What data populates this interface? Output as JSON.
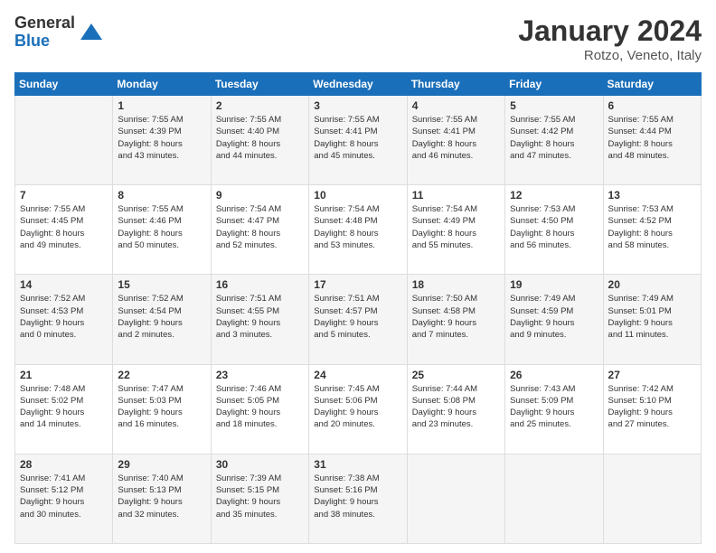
{
  "logo": {
    "general": "General",
    "blue": "Blue"
  },
  "header": {
    "month": "January 2024",
    "location": "Rotzo, Veneto, Italy"
  },
  "weekdays": [
    "Sunday",
    "Monday",
    "Tuesday",
    "Wednesday",
    "Thursday",
    "Friday",
    "Saturday"
  ],
  "weeks": [
    [
      {
        "day": "",
        "info": ""
      },
      {
        "day": "1",
        "info": "Sunrise: 7:55 AM\nSunset: 4:39 PM\nDaylight: 8 hours\nand 43 minutes."
      },
      {
        "day": "2",
        "info": "Sunrise: 7:55 AM\nSunset: 4:40 PM\nDaylight: 8 hours\nand 44 minutes."
      },
      {
        "day": "3",
        "info": "Sunrise: 7:55 AM\nSunset: 4:41 PM\nDaylight: 8 hours\nand 45 minutes."
      },
      {
        "day": "4",
        "info": "Sunrise: 7:55 AM\nSunset: 4:41 PM\nDaylight: 8 hours\nand 46 minutes."
      },
      {
        "day": "5",
        "info": "Sunrise: 7:55 AM\nSunset: 4:42 PM\nDaylight: 8 hours\nand 47 minutes."
      },
      {
        "day": "6",
        "info": "Sunrise: 7:55 AM\nSunset: 4:44 PM\nDaylight: 8 hours\nand 48 minutes."
      }
    ],
    [
      {
        "day": "7",
        "info": "Sunrise: 7:55 AM\nSunset: 4:45 PM\nDaylight: 8 hours\nand 49 minutes."
      },
      {
        "day": "8",
        "info": "Sunrise: 7:55 AM\nSunset: 4:46 PM\nDaylight: 8 hours\nand 50 minutes."
      },
      {
        "day": "9",
        "info": "Sunrise: 7:54 AM\nSunset: 4:47 PM\nDaylight: 8 hours\nand 52 minutes."
      },
      {
        "day": "10",
        "info": "Sunrise: 7:54 AM\nSunset: 4:48 PM\nDaylight: 8 hours\nand 53 minutes."
      },
      {
        "day": "11",
        "info": "Sunrise: 7:54 AM\nSunset: 4:49 PM\nDaylight: 8 hours\nand 55 minutes."
      },
      {
        "day": "12",
        "info": "Sunrise: 7:53 AM\nSunset: 4:50 PM\nDaylight: 8 hours\nand 56 minutes."
      },
      {
        "day": "13",
        "info": "Sunrise: 7:53 AM\nSunset: 4:52 PM\nDaylight: 8 hours\nand 58 minutes."
      }
    ],
    [
      {
        "day": "14",
        "info": "Sunrise: 7:52 AM\nSunset: 4:53 PM\nDaylight: 9 hours\nand 0 minutes."
      },
      {
        "day": "15",
        "info": "Sunrise: 7:52 AM\nSunset: 4:54 PM\nDaylight: 9 hours\nand 2 minutes."
      },
      {
        "day": "16",
        "info": "Sunrise: 7:51 AM\nSunset: 4:55 PM\nDaylight: 9 hours\nand 3 minutes."
      },
      {
        "day": "17",
        "info": "Sunrise: 7:51 AM\nSunset: 4:57 PM\nDaylight: 9 hours\nand 5 minutes."
      },
      {
        "day": "18",
        "info": "Sunrise: 7:50 AM\nSunset: 4:58 PM\nDaylight: 9 hours\nand 7 minutes."
      },
      {
        "day": "19",
        "info": "Sunrise: 7:49 AM\nSunset: 4:59 PM\nDaylight: 9 hours\nand 9 minutes."
      },
      {
        "day": "20",
        "info": "Sunrise: 7:49 AM\nSunset: 5:01 PM\nDaylight: 9 hours\nand 11 minutes."
      }
    ],
    [
      {
        "day": "21",
        "info": "Sunrise: 7:48 AM\nSunset: 5:02 PM\nDaylight: 9 hours\nand 14 minutes."
      },
      {
        "day": "22",
        "info": "Sunrise: 7:47 AM\nSunset: 5:03 PM\nDaylight: 9 hours\nand 16 minutes."
      },
      {
        "day": "23",
        "info": "Sunrise: 7:46 AM\nSunset: 5:05 PM\nDaylight: 9 hours\nand 18 minutes."
      },
      {
        "day": "24",
        "info": "Sunrise: 7:45 AM\nSunset: 5:06 PM\nDaylight: 9 hours\nand 20 minutes."
      },
      {
        "day": "25",
        "info": "Sunrise: 7:44 AM\nSunset: 5:08 PM\nDaylight: 9 hours\nand 23 minutes."
      },
      {
        "day": "26",
        "info": "Sunrise: 7:43 AM\nSunset: 5:09 PM\nDaylight: 9 hours\nand 25 minutes."
      },
      {
        "day": "27",
        "info": "Sunrise: 7:42 AM\nSunset: 5:10 PM\nDaylight: 9 hours\nand 27 minutes."
      }
    ],
    [
      {
        "day": "28",
        "info": "Sunrise: 7:41 AM\nSunset: 5:12 PM\nDaylight: 9 hours\nand 30 minutes."
      },
      {
        "day": "29",
        "info": "Sunrise: 7:40 AM\nSunset: 5:13 PM\nDaylight: 9 hours\nand 32 minutes."
      },
      {
        "day": "30",
        "info": "Sunrise: 7:39 AM\nSunset: 5:15 PM\nDaylight: 9 hours\nand 35 minutes."
      },
      {
        "day": "31",
        "info": "Sunrise: 7:38 AM\nSunset: 5:16 PM\nDaylight: 9 hours\nand 38 minutes."
      },
      {
        "day": "",
        "info": ""
      },
      {
        "day": "",
        "info": ""
      },
      {
        "day": "",
        "info": ""
      }
    ]
  ]
}
